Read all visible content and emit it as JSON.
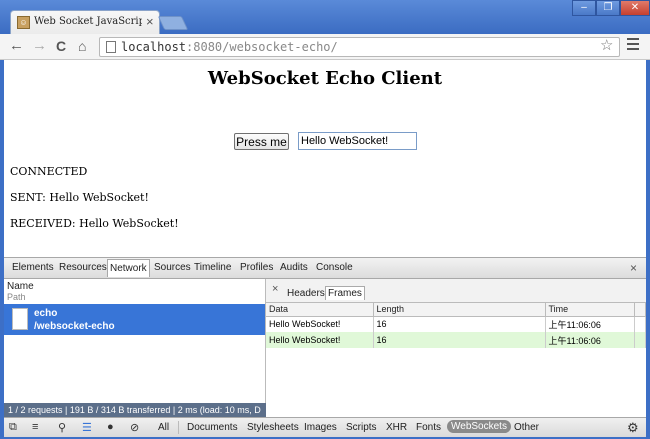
{
  "browser": {
    "tab_title": "Web Socket JavaScript E",
    "tab_close": "×",
    "window_buttons": [
      "‒",
      "❐",
      "✕"
    ],
    "nav": {
      "back": "←",
      "forward": "→",
      "reload": "C",
      "home": "⌂"
    },
    "url_host": "localhost",
    "url_rest": ":8080/websocket-echo/",
    "star": "☆"
  },
  "page": {
    "title": "WebSocket Echo Client",
    "button_label": "Press me",
    "input_value": "Hello WebSocket!",
    "lines": [
      "CONNECTED",
      "SENT: Hello WebSocket!",
      "RECEIVED: Hello WebSocket!"
    ]
  },
  "devtools": {
    "tabs": [
      "Elements",
      "Resources",
      "Network",
      "Sources",
      "Timeline",
      "Profiles",
      "Audits",
      "Console"
    ],
    "active_tab": "Network",
    "close": "×",
    "request_list": {
      "col_name": "Name",
      "col_path": "Path",
      "request_name": "echo",
      "request_path": "/websocket-echo",
      "status": "1 / 2 requests  |  191 B / 314 B transferred  |  2 ms (load: 10 ms, D"
    },
    "detail": {
      "close": "×",
      "tabs": [
        "Headers",
        "Frames"
      ],
      "active_tab": "Frames",
      "columns": [
        "Data",
        "Length",
        "Time"
      ],
      "rows": [
        {
          "data": "Hello WebSocket!",
          "length": "16",
          "time": "上午11:06:06",
          "type": "sent"
        },
        {
          "data": "Hello WebSocket!",
          "length": "16",
          "time": "上午11:06:06",
          "type": "received"
        }
      ]
    },
    "filters": [
      "All",
      "Documents",
      "Stylesheets",
      "Images",
      "Scripts",
      "XHR",
      "Fonts",
      "WebSockets",
      "Other"
    ],
    "active_filter": "WebSockets"
  },
  "colors": {
    "selected_row": "#3875d7",
    "received_row": "#e0f8d8",
    "window_frame": "#3d6fc6"
  }
}
